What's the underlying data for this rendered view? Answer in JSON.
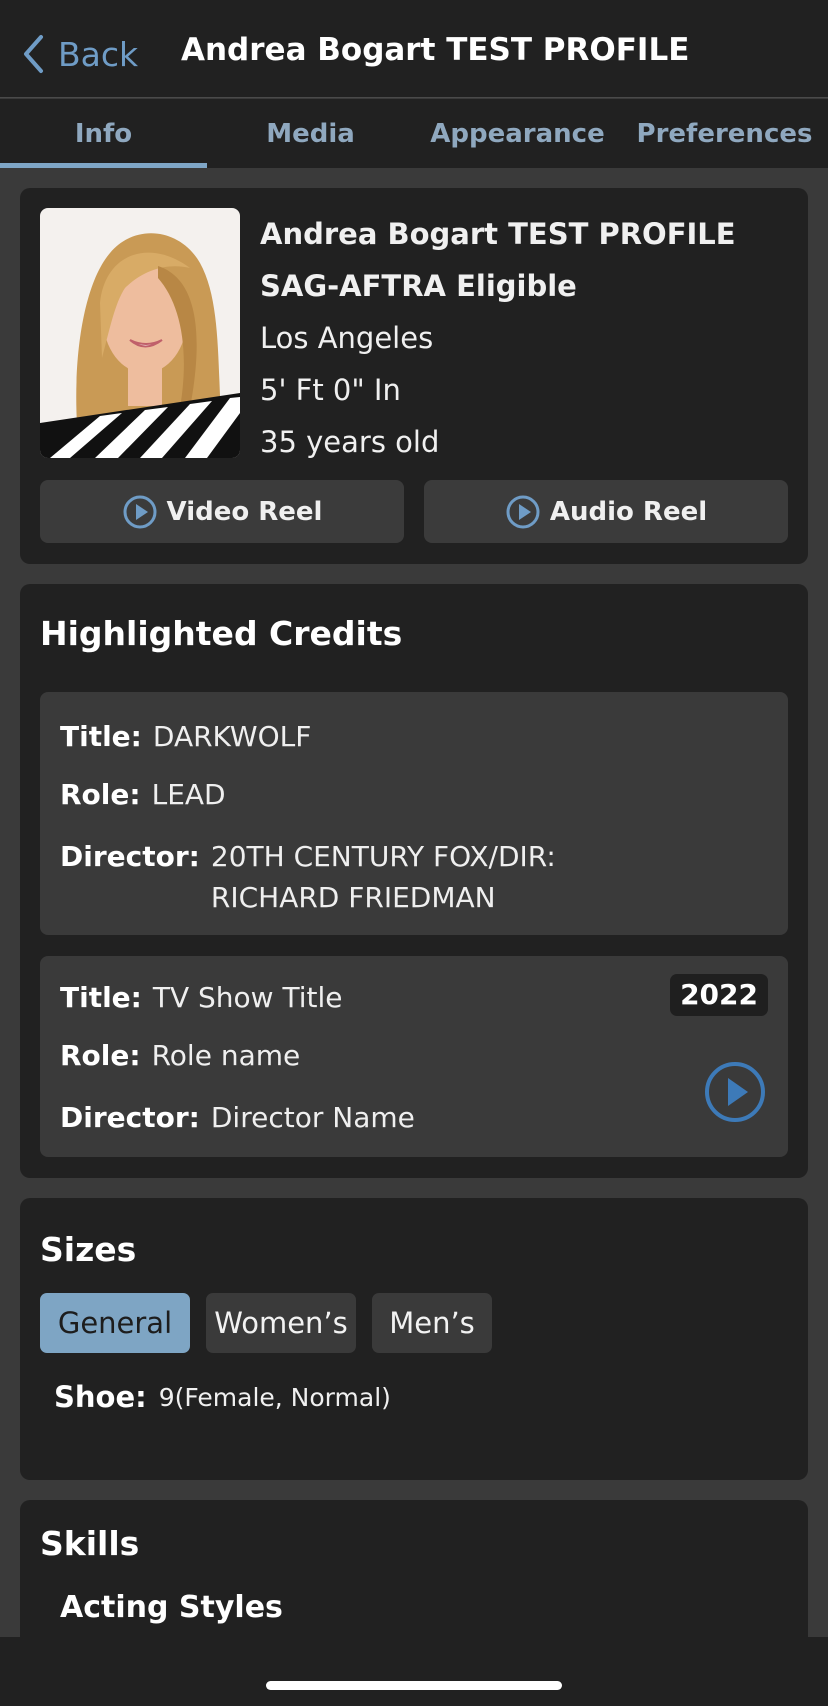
{
  "header": {
    "back_label": "Back",
    "title": "Andrea Bogart TEST PROFILE"
  },
  "tabs": [
    {
      "label": "Info",
      "active": true
    },
    {
      "label": "Media",
      "active": false
    },
    {
      "label": "Appearance",
      "active": false
    },
    {
      "label": "Preferences",
      "active": false
    }
  ],
  "profile": {
    "name": "Andrea Bogart TEST PROFILE",
    "union": "SAG-AFTRA Eligible",
    "location": "Los Angeles",
    "height": "5' Ft 0\" In",
    "age": "35 years old",
    "video_reel_label": "Video Reel",
    "audio_reel_label": "Audio Reel"
  },
  "credits": {
    "section_title": "Highlighted Credits",
    "title_label": "Title:",
    "role_label": "Role:",
    "director_label": "Director:",
    "items": [
      {
        "title": "DARKWOLF",
        "role": "LEAD",
        "director": "20TH CENTURY FOX/DIR: RICHARD FRIEDMAN",
        "director_line1": "20TH CENTURY FOX/DIR:",
        "director_line2": "RICHARD FRIEDMAN"
      },
      {
        "title": "TV Show Title",
        "role": "Role name",
        "director": "Director Name",
        "year": "2022"
      }
    ]
  },
  "sizes": {
    "section_title": "Sizes",
    "tabs": [
      {
        "label": "General",
        "active": true
      },
      {
        "label": "Women’s",
        "active": false
      },
      {
        "label": "Men’s",
        "active": false
      }
    ],
    "shoe_label": "Shoe:",
    "shoe_value": "9(Female, Normal)"
  },
  "skills": {
    "section_title": "Skills",
    "first_group": "Acting Styles"
  },
  "colors": {
    "accent": "#7ea5c4",
    "link": "#6f9cc6",
    "play_icon": "#3d7ab8",
    "card_bg": "#212121",
    "page_bg": "#3a3a3a"
  },
  "icons": {
    "back": "chevron-left-icon",
    "reel": "play-circle-icon",
    "credit_media": "play-circle-icon"
  }
}
